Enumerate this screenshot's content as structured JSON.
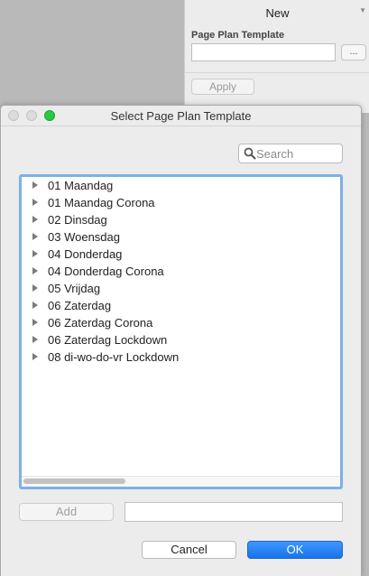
{
  "background_panel": {
    "title": "New",
    "template_label": "Page Plan Template",
    "template_value": "",
    "browse_label": "...",
    "apply_label": "Apply"
  },
  "dialog": {
    "title": "Select Page Plan Template",
    "search": {
      "placeholder": "Search",
      "value": ""
    },
    "templates": [
      "01 Maandag",
      "01 Maandag Corona",
      "02 Dinsdag",
      "03 Woensdag",
      "04 Donderdag",
      "04 Donderdag Corona",
      "05 Vrijdag",
      "06 Zaterdag",
      "06 Zaterdag Corona",
      "06 Zaterdag Lockdown",
      "08 di-wo-do-vr Lockdown"
    ],
    "add_label": "Add",
    "add_value": "",
    "cancel_label": "Cancel",
    "ok_label": "OK",
    "accent_color": "#1a73ea"
  }
}
